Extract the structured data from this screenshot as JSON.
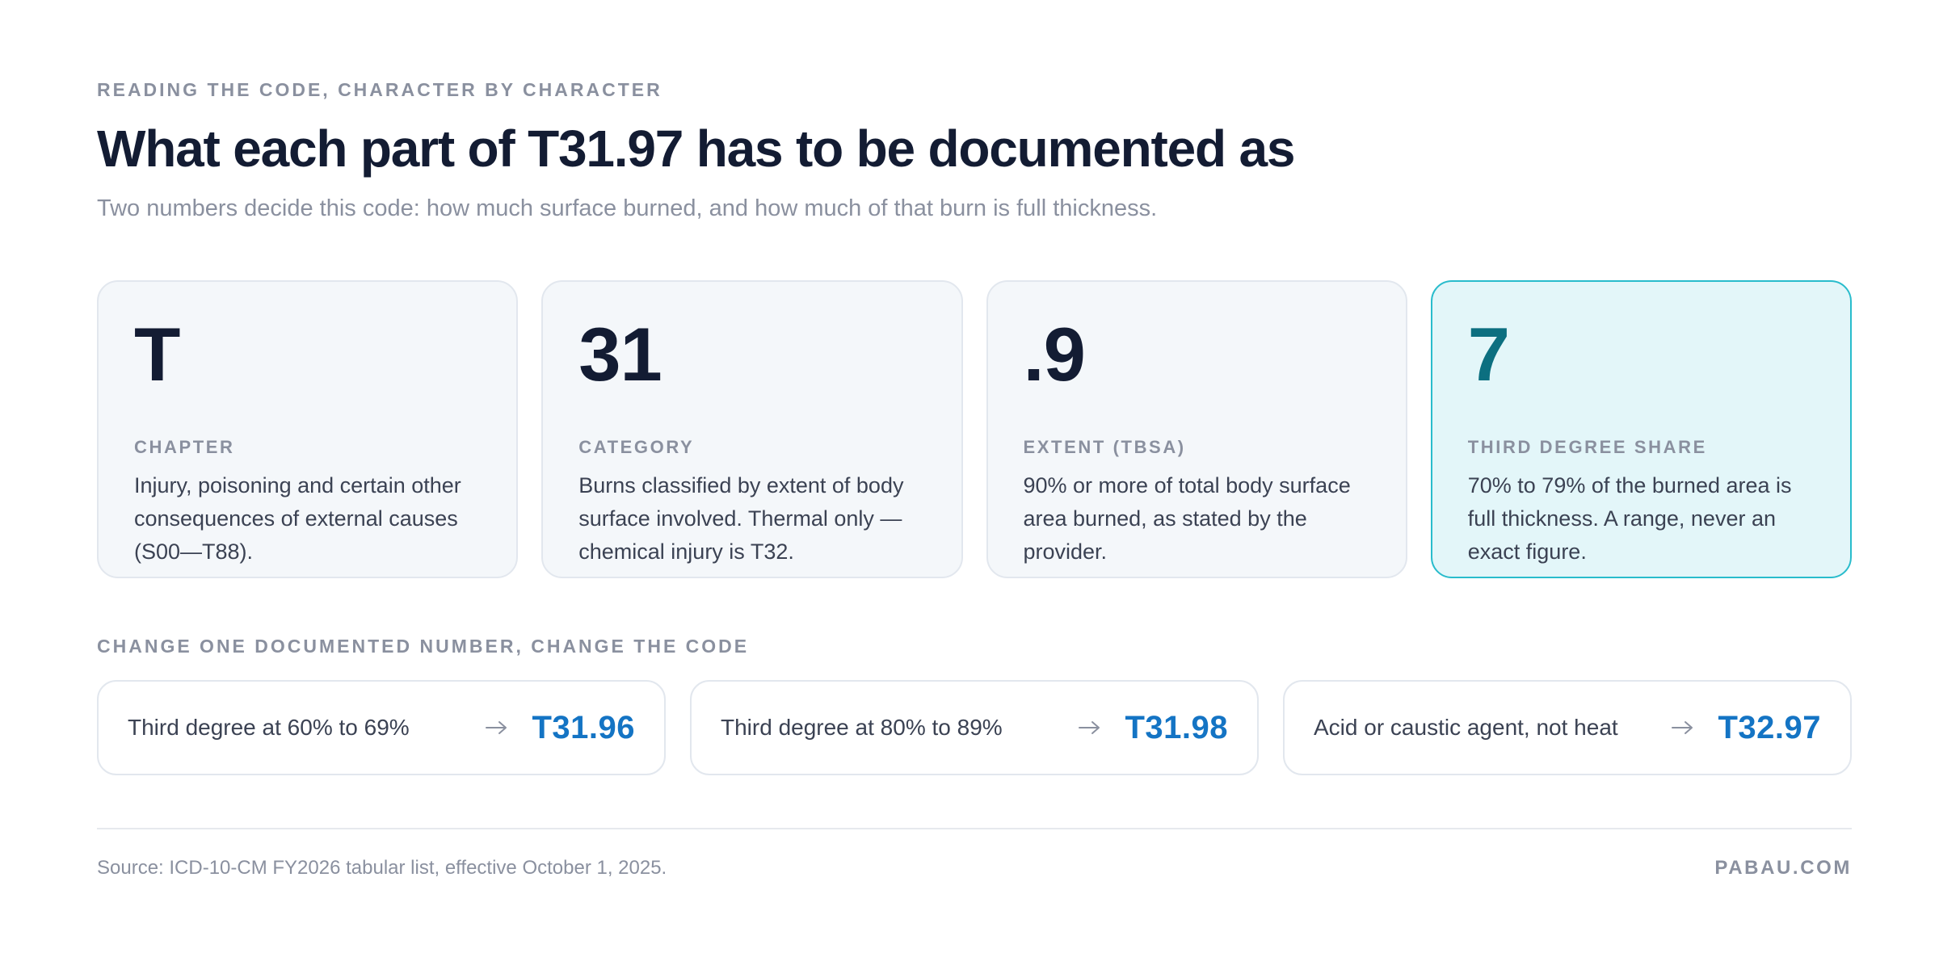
{
  "header": {
    "eyebrow": "READING THE CODE, CHARACTER BY CHARACTER",
    "title": "What each part of T31.97 has to be documented as",
    "subtitle": "Two numbers decide this code: how much surface burned, and how much of that burn is full thickness."
  },
  "cards": [
    {
      "value": "T",
      "label": "CHAPTER",
      "description": "Injury, poisoning and certain other consequences of external causes (S00—T88)."
    },
    {
      "value": "31",
      "label": "CATEGORY",
      "description": "Burns classified by extent of body surface involved. Thermal only — chemical injury is T32."
    },
    {
      "value": ".9",
      "label": "EXTENT (TBSA)",
      "description": "90% or more of total body surface area burned, as stated by the provider."
    },
    {
      "value": "7",
      "label": "THIRD DEGREE SHARE",
      "description": "70% to 79% of the burned area is full thickness. A range, never an exact figure."
    }
  ],
  "changes": {
    "section_label": "CHANGE ONE DOCUMENTED NUMBER, CHANGE THE CODE",
    "items": [
      {
        "text": "Third degree at 60% to 69%",
        "code": "T31.96"
      },
      {
        "text": "Third degree at 80% to 89%",
        "code": "T31.98"
      },
      {
        "text": "Acid or caustic agent, not heat",
        "code": "T32.97"
      }
    ]
  },
  "footer": {
    "source": "Source: ICD-10-CM FY2026 tabular list, effective October 1, 2025.",
    "brand": "PABAU.COM"
  },
  "colors": {
    "title": "#131c33",
    "muted": "#8a909f",
    "highlight_border": "#29bccc",
    "highlight_bg": "#e3f6f9",
    "highlight_value": "#0c6f80",
    "code_accent": "#1474c4"
  },
  "icons": {
    "change_arrow": "arrow-right-icon"
  }
}
